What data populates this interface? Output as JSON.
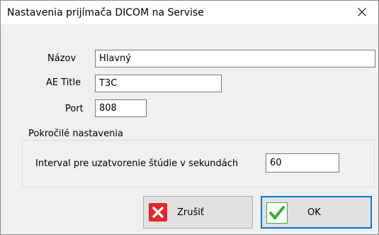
{
  "window": {
    "title": "Nastavenia prijímača DICOM na Servise"
  },
  "form": {
    "name_label": "Názov",
    "name_value": "Hlavný",
    "ae_title_label": "AE Title",
    "ae_title_value": "T3C",
    "port_label": "Port",
    "port_value": "808"
  },
  "advanced": {
    "group_label": "Pokročilé nastavenia",
    "interval_label": "Interval pre uzatvorenie štúdie v sekundách",
    "interval_value": "60"
  },
  "buttons": {
    "cancel_label": "Zrušiť",
    "ok_label": "OK"
  },
  "icons": {
    "close": "close-icon",
    "cancel": "red-x-icon",
    "ok": "green-check-icon"
  },
  "colors": {
    "default_button_border": "#0078d7",
    "cancel_icon": "#e02828",
    "ok_icon": "#34b233"
  }
}
